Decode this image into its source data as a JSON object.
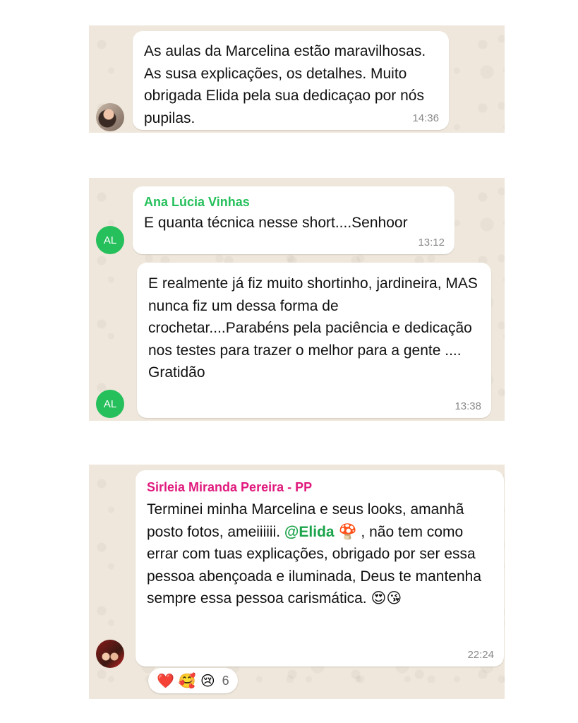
{
  "messages": [
    {
      "sender": "",
      "text": "As aulas da Marcelina estão maravilhosas. As susa explicações, os detalhes. Muito obrigada Elida pela sua dedicaçao  por nós pupilas.",
      "time": "14:36",
      "avatar": "profile-photo"
    },
    {
      "sender": "Ana Lúcia Vinhas",
      "sender_color": "#25c05b",
      "text": "E quanta técnica nesse short....Senhoor",
      "time": "13:12",
      "avatar_initials": "AL"
    },
    {
      "sender": "",
      "text": "E realmente já fiz muito shortinho, jardineira, MAS nunca fiz um dessa forma de crochetar....Parabéns pela paciência e dedicação nos testes para trazer o melhor para a gente .... Gratidão",
      "time": "13:38",
      "avatar_initials": "AL"
    },
    {
      "sender": "Sirleia Miranda Pereira  - PP",
      "sender_color": "#e0197d",
      "text_before_mention": "Terminei minha Marcelina e seus looks, amanhã posto fotos,  ameiiiiii. ",
      "mention": "@Elida",
      "mention_emoji": "🍄",
      "text_after_mention": " , não tem como errar com tuas explicações,  obrigado por ser essa pessoa abençoada e iluminada,  Deus te mantenha sempre essa pessoa carismática.  ",
      "trailing_emojis": "😍😘",
      "time": "22:24",
      "avatar": "group-photo",
      "reactions": {
        "emojis": [
          "❤️",
          "🥰",
          "😢"
        ],
        "count": "6"
      }
    }
  ],
  "colors": {
    "chat_background": "#efe7db",
    "bubble": "#ffffff",
    "timestamp": "#8a8a8a",
    "mention": "#1aa34a"
  }
}
